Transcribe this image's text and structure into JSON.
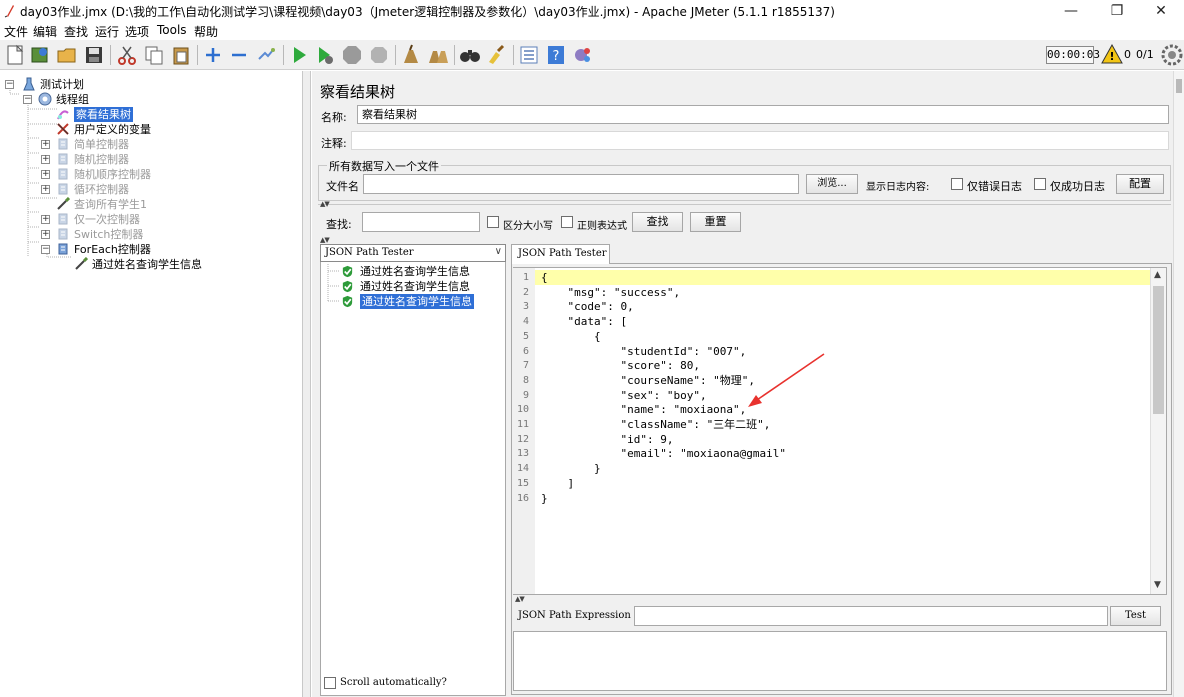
{
  "window": {
    "title": "day03作业.jmx (D:\\我的工作\\自动化测试学习\\课程视频\\day03（Jmeter逻辑控制器及参数化）\\day03作业.jmx) - Apache JMeter (5.1.1 r1855137)",
    "min_glyph": "—",
    "max_glyph": "❐",
    "close_glyph": "✕"
  },
  "menu": [
    "文件",
    "编辑",
    "查找",
    "运行",
    "选项",
    "Tools",
    "帮助"
  ],
  "status": {
    "timer": "00:00:03",
    "error_count": "0",
    "threads": "0/1"
  },
  "tree": {
    "nodes": [
      {
        "label": "测试计划",
        "level": 0,
        "expander": "−",
        "disabled": false,
        "selected": false,
        "icon": "test-plan-icon"
      },
      {
        "label": "线程组",
        "level": 1,
        "expander": "−",
        "disabled": false,
        "selected": false,
        "icon": "thread-group-icon"
      },
      {
        "label": "察看结果树",
        "level": 2,
        "expander": "",
        "disabled": false,
        "selected": true,
        "icon": "results-tree-icon"
      },
      {
        "label": "用户定义的变量",
        "level": 2,
        "expander": "",
        "disabled": false,
        "selected": false,
        "icon": "variables-icon"
      },
      {
        "label": "简单控制器",
        "level": 2,
        "expander": "+",
        "disabled": true,
        "selected": false,
        "icon": "controller-icon"
      },
      {
        "label": "随机控制器",
        "level": 2,
        "expander": "+",
        "disabled": true,
        "selected": false,
        "icon": "controller-icon"
      },
      {
        "label": "随机顺序控制器",
        "level": 2,
        "expander": "+",
        "disabled": true,
        "selected": false,
        "icon": "controller-icon"
      },
      {
        "label": "循环控制器",
        "level": 2,
        "expander": "+",
        "disabled": true,
        "selected": false,
        "icon": "controller-icon"
      },
      {
        "label": "查询所有学生1",
        "level": 2,
        "expander": "",
        "disabled": true,
        "selected": false,
        "icon": "sampler-icon"
      },
      {
        "label": "仅一次控制器",
        "level": 2,
        "expander": "+",
        "disabled": true,
        "selected": false,
        "icon": "controller-icon"
      },
      {
        "label": "Switch控制器",
        "level": 2,
        "expander": "+",
        "disabled": true,
        "selected": false,
        "icon": "controller-icon"
      },
      {
        "label": "ForEach控制器",
        "level": 2,
        "expander": "−",
        "disabled": false,
        "selected": false,
        "icon": "controller-icon"
      },
      {
        "label": "通过姓名查询学生信息",
        "level": 3,
        "expander": "",
        "disabled": false,
        "selected": false,
        "icon": "sampler-icon"
      }
    ]
  },
  "panel": {
    "title": "察看结果树",
    "name_label": "名称:",
    "name_value": "察看结果树",
    "comment_label": "注释:",
    "comment_value": "",
    "file_group_label": "所有数据写入一个文件",
    "filename_label": "文件名",
    "filename_value": "",
    "browse_button": "浏览...",
    "log_label": "显示日志内容:",
    "errors_only_label": "仅错误日志",
    "success_only_label": "仅成功日志",
    "config_button": "配置",
    "search_label": "查找:",
    "search_value": "",
    "case_label": "区分大小写",
    "regex_label": "正则表达式",
    "search_button": "查找",
    "reset_button": "重置"
  },
  "results": {
    "renderer": "JSON Path Tester",
    "items": [
      {
        "label": "通过姓名查询学生信息",
        "selected": false
      },
      {
        "label": "通过姓名查询学生信息",
        "selected": false
      },
      {
        "label": "通过姓名查询学生信息",
        "selected": true
      }
    ],
    "scroll_auto_label": "Scroll automatically?"
  },
  "json_tab": {
    "tab_label": "JSON Path Tester",
    "line_numbers": [
      "1",
      "2",
      "3",
      "4",
      "5",
      "6",
      "7",
      "8",
      "9",
      "10",
      "11",
      "12",
      "13",
      "14",
      "15",
      "16"
    ],
    "code_lines": [
      "{",
      "    \"msg\": \"success\",",
      "    \"code\": 0,",
      "    \"data\": [",
      "        {",
      "            \"studentId\": \"007\",",
      "            \"score\": 80,",
      "            \"courseName\": \"物理\",",
      "            \"sex\": \"boy\",",
      "            \"name\": \"moxiaona\",",
      "            \"className\": \"三年二班\",",
      "            \"id\": 9,",
      "            \"email\": \"moxiaona@gmail\"",
      "        }",
      "    ]",
      "}"
    ],
    "expression_label": "JSON Path Expression",
    "expression_value": "",
    "test_button": "Test"
  },
  "colors": {
    "selection": "#2f6fd6",
    "highlight_line": "#ffffaa",
    "annotation_arrow": "#e8322e"
  }
}
